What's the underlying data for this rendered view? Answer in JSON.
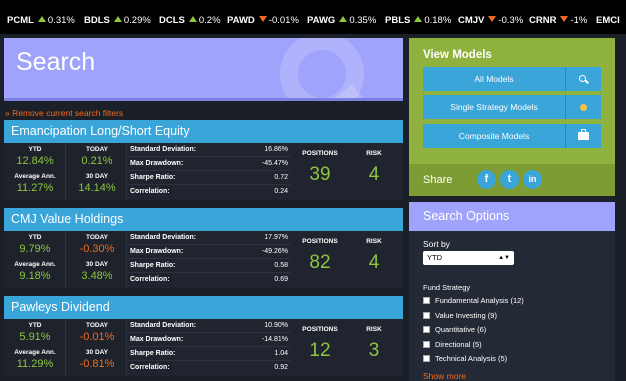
{
  "ticker": [
    {
      "symbol": "PCML",
      "dir": "up",
      "value": "0.31%"
    },
    {
      "symbol": "BDLS",
      "dir": "up",
      "value": "0.29%"
    },
    {
      "symbol": "DCLS",
      "dir": "up",
      "value": "0.2%"
    },
    {
      "symbol": "PAWD",
      "dir": "down",
      "value": "-0.01%"
    },
    {
      "symbol": "PAWG",
      "dir": "up",
      "value": "0.35%"
    },
    {
      "symbol": "PBLS",
      "dir": "up",
      "value": "0.18%"
    },
    {
      "symbol": "CMJV",
      "dir": "down",
      "value": "-0.3%"
    },
    {
      "symbol": "CRNR",
      "dir": "down",
      "value": "-1%"
    },
    {
      "symbol": "EMCI",
      "dir": "",
      "value": ""
    }
  ],
  "search": {
    "title": "Search",
    "remove_filters": "» Remove current search filters"
  },
  "labels": {
    "ytd": "YTD",
    "today": "TODAY",
    "avg_ann": "Average Ann.",
    "thirty_day": "30 DAY",
    "std_dev": "Standard Deviation:",
    "max_dd": "Max Drawdown:",
    "sharpe": "Sharpe Ratio:",
    "corr": "Correlation:",
    "positions": "POSITIONS",
    "risk": "RISK"
  },
  "funds": [
    {
      "name": "Emancipation Long/Short Equity",
      "ytd": "12.84%",
      "today": "0.21%",
      "avg_ann": "11.27%",
      "thirty_day": "14.14%",
      "std_dev": "16.86%",
      "max_dd": "-45.47%",
      "sharpe": "0.72",
      "corr": "0.24",
      "positions": "39",
      "risk": "4",
      "today_neg": false,
      "thirty_neg": false
    },
    {
      "name": "CMJ Value Holdings",
      "ytd": "9.79%",
      "today": "-0.30%",
      "avg_ann": "9.18%",
      "thirty_day": "3.48%",
      "std_dev": "17.97%",
      "max_dd": "-49.26%",
      "sharpe": "0.58",
      "corr": "0.69",
      "positions": "82",
      "risk": "4",
      "today_neg": true,
      "thirty_neg": false
    },
    {
      "name": "Pawleys Dividend",
      "ytd": "5.91%",
      "today": "-0.01%",
      "avg_ann": "11.29%",
      "thirty_day": "-0.81%",
      "std_dev": "10.90%",
      "max_dd": "-14.81%",
      "sharpe": "1.04",
      "corr": "0.92",
      "positions": "12",
      "risk": "3",
      "today_neg": true,
      "thirty_neg": true
    }
  ],
  "view_models": {
    "title": "View Models",
    "buttons": [
      {
        "label": "All Models",
        "icon": "search-icon"
      },
      {
        "label": "Single Strategy Models",
        "icon": "dot-icon"
      },
      {
        "label": "Composite Models",
        "icon": "briefcase-icon"
      }
    ],
    "share_label": "Share",
    "social": [
      {
        "icon": "facebook-icon",
        "glyph": "f"
      },
      {
        "icon": "twitter-icon",
        "glyph": "t"
      },
      {
        "icon": "linkedin-icon",
        "glyph": "in"
      }
    ]
  },
  "search_options": {
    "title": "Search Options",
    "sort_by_label": "Sort by",
    "sort_value": "YTD",
    "fund_strategy_label": "Fund Strategy",
    "strategies": [
      "Fundamental Analysis (12)",
      "Value Investing (9)",
      "Quantitative (6)",
      "Directional (5)",
      "Technical Analysis (5)"
    ],
    "show_more": "Show more"
  },
  "colors": {
    "accent_blue": "#3aa5d9",
    "periwinkle": "#9fa3fb",
    "green": "#8dc63f",
    "orange": "#f26b21",
    "olive": "#8fb13e"
  }
}
